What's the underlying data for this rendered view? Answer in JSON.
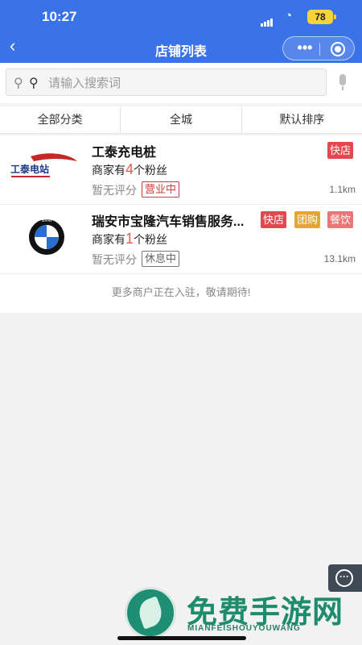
{
  "status_bar": {
    "time": "10:27",
    "battery": "78"
  },
  "nav": {
    "title": "店铺列表",
    "more": "•••"
  },
  "search": {
    "placeholder": "请输入搜索词"
  },
  "filters": [
    "全部分类",
    "全城",
    "默认排序"
  ],
  "stores": [
    {
      "name": "工泰充电桩",
      "logo_text": "工泰电站",
      "fans_prefix": "商家有",
      "fans_count": "4",
      "fans_suffix": "个粉丝",
      "rating": "暂无评分",
      "status": "营业中",
      "distance": "1.1km",
      "tags": [
        "快店"
      ]
    },
    {
      "name": "瑞安市宝隆汽车销售服务...",
      "logo_text": "BMW",
      "fans_prefix": "商家有",
      "fans_count": "1",
      "fans_suffix": "个粉丝",
      "rating": "暂无评分",
      "status": "休息中",
      "distance": "13.1km",
      "tags": [
        "快店",
        "团购",
        "餐饮"
      ]
    }
  ],
  "footer_note": "更多商户正在入驻，敬请期待!",
  "watermark": {
    "title": "免费手游网",
    "subtitle": "MIANFEISHOUYOUWANG"
  },
  "colors": {
    "header": "#3a72e8",
    "accent_red": "#e45c4a",
    "tag_red": "#e5474f",
    "tag_gold": "#e4a631",
    "tag_pink": "#eb7676"
  }
}
